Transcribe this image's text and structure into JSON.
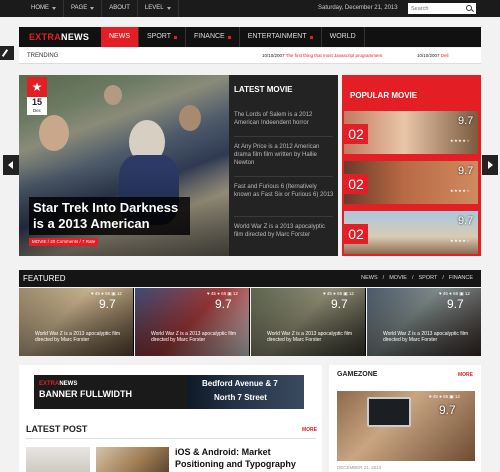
{
  "topbar": {
    "menu": [
      {
        "label": "HOME",
        "has_dropdown": true
      },
      {
        "label": "PAGE",
        "has_dropdown": true
      },
      {
        "label": "ABOUT",
        "has_dropdown": false
      },
      {
        "label": "LEVEL",
        "has_dropdown": true
      }
    ],
    "date": "Saturday, December 21, 2013",
    "search_placeholder": "Search"
  },
  "logo": {
    "part1": "EXTRA",
    "part2": "NEWS"
  },
  "nav": [
    {
      "label": "NEWS",
      "active": true
    },
    {
      "label": "SPORT"
    },
    {
      "label": "FINANCE"
    },
    {
      "label": "ENTERTAINMENT"
    },
    {
      "label": "WORLD"
    }
  ],
  "trending": {
    "label": "TRENDING",
    "items": [
      {
        "date": "10/10/2007",
        "text": "The first thing that most Javascript programmers"
      },
      {
        "date": "10/10/2007",
        "text": "Dell"
      }
    ]
  },
  "hero": {
    "day": "15",
    "month": "Dec",
    "title": "Star Trek Into Darkness is a 2013 American",
    "meta": "MOVIE / 20 Comments / 7 Rate"
  },
  "latest_movie": {
    "heading": "LATEST MOVIE",
    "items": [
      "The Lords of Salem is a 2012 American Indeendent horror",
      "At Any Price is a 2012 American drama film film written by Hallie Newton",
      "Fast and Furious 6 (Iternatively known as Fast Six or Furious 6) 2013",
      "World War Z is a 2013 apocalyptic film directed by Marc Forster"
    ]
  },
  "popular_movie": {
    "heading": "POPULAR MOVIE",
    "items": [
      {
        "num": "02",
        "score": "9.7",
        "rating": 4
      },
      {
        "num": "02",
        "score": "9.7",
        "rating": 4
      },
      {
        "num": "02",
        "score": "9.7",
        "rating": 4
      }
    ]
  },
  "featured": {
    "heading": "FEATURED",
    "links": [
      "NEWS",
      "/",
      "MOVIE",
      "/",
      "SPORT",
      "/",
      "FINANCE"
    ],
    "cards": [
      {
        "stats": "♥ 45 ● 65 ▣ 12",
        "score": "9.7",
        "caption": "World War Z is a 2013 apocalyptic film directed by Marc Forster"
      },
      {
        "stats": "♥ 45 ● 65 ▣ 12",
        "score": "9.7",
        "caption": "World War Z is a 2013 apocalyptic film directed by Marc Forster"
      },
      {
        "stats": "♥ 45 ● 65 ▣ 12",
        "score": "9.7",
        "caption": "World War Z is a 2013 apocalyptic film directed by Marc Forster"
      },
      {
        "stats": "♥ 45 ● 65 ▣ 12",
        "score": "9.7",
        "caption": "World War Z is a 2013 apocalyptic film directed by Marc Forster"
      }
    ]
  },
  "banner": {
    "brand1": "EXTRA",
    "brand2": "NEWS",
    "title": "BANNER FULLWIDTH",
    "sign_line1": "Bedford Avenue & 7",
    "sign_line2": "North 7 Street"
  },
  "latest_post": {
    "heading": "LATEST POST",
    "more": "MORE",
    "title": "iOS & Android: Market Positioning and Typography"
  },
  "gamezone": {
    "heading": "GAMEZONE",
    "more": "MORE",
    "stats": "♥ 45 ● 65 ▣ 12",
    "score": "9.7",
    "date": "DECEMBER 21, 2013"
  },
  "colors": {
    "accent": "#e31e24",
    "dark": "#111111"
  }
}
